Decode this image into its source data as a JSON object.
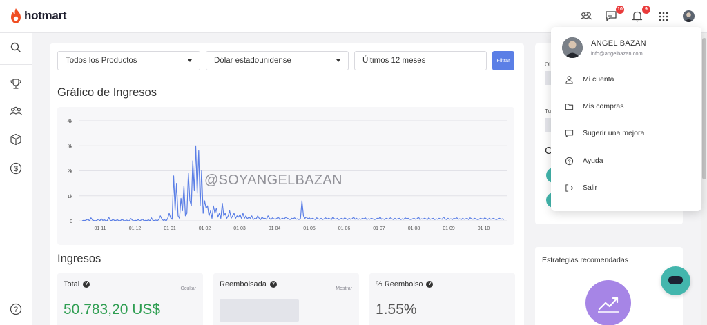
{
  "app": {
    "brand": "hotmart",
    "brand_color": "#f04e23",
    "accent": "#5b7fe6"
  },
  "header": {
    "icons": [
      "community-icon",
      "messages-icon",
      "notifications-icon",
      "apps-grid-icon"
    ],
    "messages_badge": "10",
    "notifications_badge": "9"
  },
  "sidebar": {
    "items": [
      "search-icon",
      "trophy-icon",
      "community-icon",
      "box-icon",
      "dollar-icon"
    ],
    "bottom": "help-icon"
  },
  "filters": {
    "product": "Todos los Productos",
    "currency": "Dólar estadounidense",
    "period": "Últimos 12 meses",
    "button": "Filtrar"
  },
  "chart_section": {
    "title": "Gráfico de Ingresos",
    "watermark": "@SOYANGELBAZAN"
  },
  "chart_data": {
    "type": "line",
    "title": "Gráfico de Ingresos",
    "y_ticks": [
      "0",
      "1k",
      "2k",
      "3k",
      "4k"
    ],
    "ylim": [
      0,
      4000
    ],
    "x_ticks": [
      "01 11",
      "01 12",
      "01 01",
      "01 02",
      "01 03",
      "01 04",
      "01 05",
      "01 06",
      "01 07",
      "01 08",
      "01 09",
      "01 10"
    ],
    "grid": true,
    "series": [
      {
        "color": "#5b7fe6",
        "values": [
          0,
          20,
          10,
          40,
          60,
          0,
          120,
          30,
          10,
          0,
          20,
          60,
          0,
          80,
          20,
          40,
          10,
          0,
          150,
          20,
          10,
          70,
          0,
          20,
          40,
          0,
          10,
          60,
          20,
          0,
          30,
          10,
          0,
          90,
          30,
          0,
          20,
          10,
          50,
          0,
          30,
          60,
          0,
          20,
          10,
          40,
          0,
          120,
          20,
          10,
          30,
          0,
          60,
          200,
          80,
          20,
          40,
          0,
          100,
          300,
          120,
          60,
          1800,
          400,
          1500,
          200,
          100,
          900,
          400,
          1400,
          200,
          300,
          1900,
          800,
          600,
          2400,
          1200,
          3000,
          1100,
          2800,
          600,
          2000,
          300,
          800,
          500,
          600,
          200,
          400,
          100,
          600,
          300,
          500,
          150,
          300,
          100,
          700,
          200,
          300,
          100,
          200,
          400,
          100,
          200,
          300,
          100,
          200,
          150,
          250,
          100,
          300,
          100,
          200,
          80,
          150,
          100,
          200,
          50,
          100,
          80,
          200,
          100,
          50,
          150,
          80,
          100,
          60,
          200,
          100,
          50,
          120,
          80,
          60,
          100,
          150,
          50,
          80,
          100,
          60,
          150,
          100,
          80,
          50,
          100,
          80,
          120,
          60,
          80,
          50,
          100,
          800,
          200,
          100,
          150,
          80,
          120,
          60,
          100,
          80,
          50,
          120,
          80,
          60,
          100,
          50,
          80,
          120,
          60,
          100,
          80,
          50,
          150,
          80,
          60,
          100,
          50,
          80,
          100,
          60,
          120,
          80,
          50,
          100,
          60,
          80,
          150,
          60,
          100,
          50,
          80,
          60,
          100,
          80,
          120,
          50,
          80,
          60,
          100,
          80,
          50,
          60,
          100,
          80,
          150,
          60,
          80,
          50,
          100,
          80,
          60,
          120,
          80,
          50,
          100,
          60,
          80,
          100,
          50,
          80,
          60,
          120,
          80,
          100,
          60,
          50,
          80,
          100,
          60,
          80,
          150,
          50,
          80,
          60,
          100,
          80,
          50,
          120,
          60,
          80,
          100,
          50,
          80,
          60,
          100,
          80,
          60,
          150,
          80,
          50,
          100,
          60,
          80,
          50,
          100,
          80,
          120,
          60,
          80,
          50,
          100,
          60,
          80,
          100,
          50,
          120,
          80,
          60,
          100,
          80,
          50,
          60,
          100,
          80,
          60,
          120,
          80,
          50,
          100,
          60,
          80,
          100,
          60,
          50,
          80,
          100,
          60,
          80,
          50
        ]
      }
    ]
  },
  "ingresos": {
    "title": "Ingresos",
    "cards": [
      {
        "label": "Total",
        "action": "Ocultar",
        "value": "50.783,20 US$",
        "value_color": "#2f9e52"
      },
      {
        "label": "Reembolsada",
        "action": "Mostrar",
        "value": ""
      },
      {
        "label": "% Reembolso",
        "action": "",
        "value": "1.55%",
        "value_color": "#555"
      }
    ]
  },
  "right": {
    "recommended_title": "Estrategias recomendadas",
    "partial_labels": [
      "Ol",
      "Tu",
      "C"
    ]
  },
  "user_menu": {
    "name": "ANGEL BAZAN",
    "email": "info@angelbazan.com",
    "items": [
      {
        "label": "Mi cuenta",
        "icon": "user-icon"
      },
      {
        "label": "Mis compras",
        "icon": "folder-icon"
      },
      {
        "label": "Sugerir una mejora",
        "icon": "comment-icon"
      },
      {
        "label": "Ayuda",
        "icon": "help-icon"
      },
      {
        "label": "Salir",
        "icon": "logout-icon"
      }
    ]
  }
}
